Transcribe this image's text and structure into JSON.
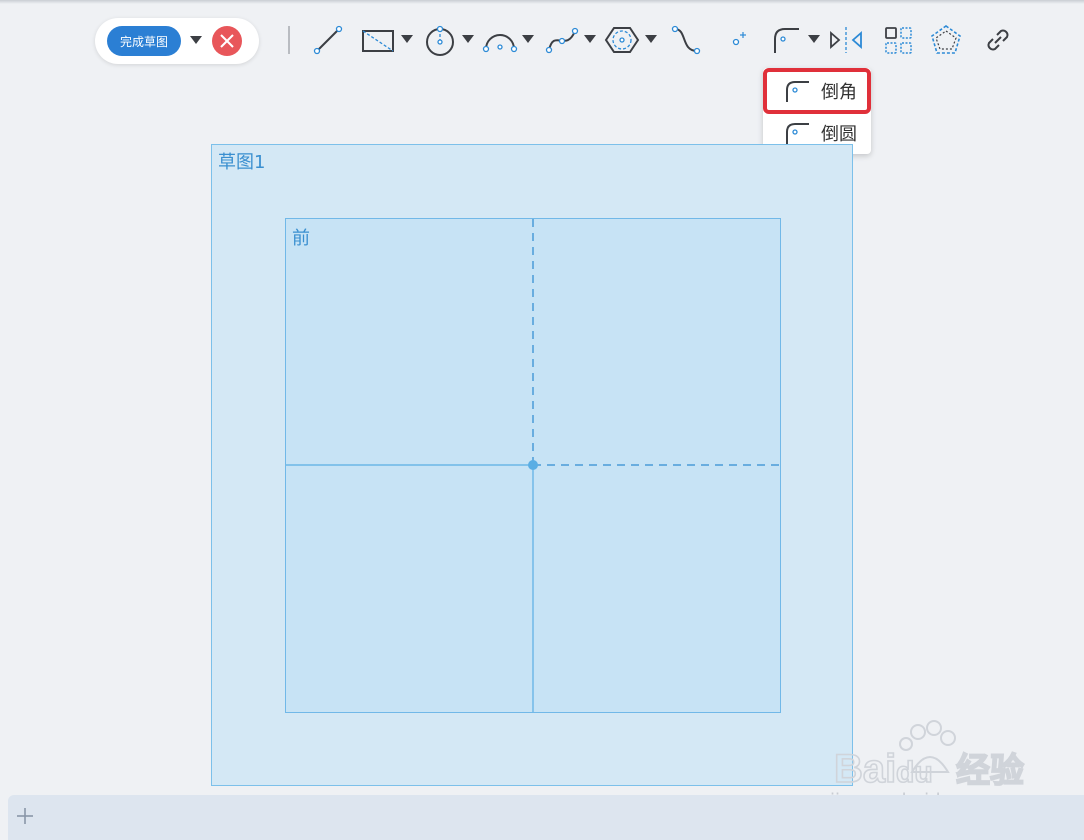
{
  "toolbar": {
    "finish_label": "完成草图"
  },
  "menu": {
    "items": [
      {
        "label": "倒角"
      },
      {
        "label": "倒圆"
      }
    ]
  },
  "canvas": {
    "sketch_label": "草图1",
    "plane_label": "前"
  },
  "watermark": {
    "url": "jingyan.baidu.com"
  },
  "colors": {
    "accent": "#2b7fd4",
    "cancel": "#e8565a",
    "highlight": "#e0303a",
    "sketch": "#d4e8f5",
    "icon_blue": "#2c8ad6"
  }
}
